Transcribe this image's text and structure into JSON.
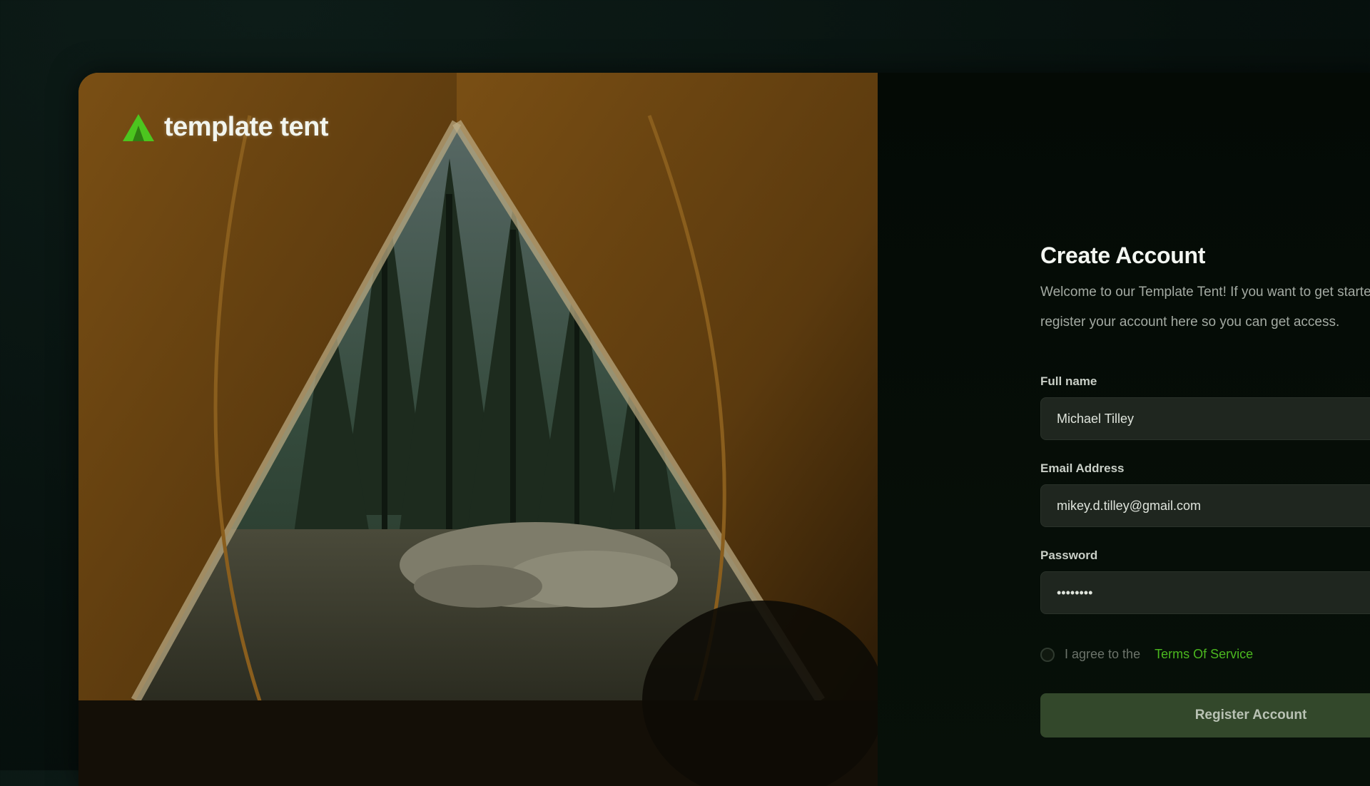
{
  "brand": {
    "name": "template tent",
    "icon": "tent-logo-icon",
    "accent": "#4cc51f"
  },
  "form": {
    "title": "Create Account",
    "subtitle": "Welcome to our Template Tent! If you want to get started, please register your account here so you can get access.",
    "fields": [
      {
        "label": "Full name",
        "value": "Michael Tilley",
        "type": "text"
      },
      {
        "label": "Email Address",
        "value": "mikey.d.tilley@gmail.com",
        "type": "email"
      },
      {
        "label": "Password",
        "value": "password",
        "type": "password"
      }
    ],
    "terms": {
      "text": "I agree to the",
      "link": "Terms Of Service",
      "checked": false
    },
    "submit_label": "Register Account"
  },
  "colors": {
    "background": "#050b06",
    "input_bg": "#1f261f",
    "button_bg": "#33482b",
    "link": "#4bb81f"
  }
}
